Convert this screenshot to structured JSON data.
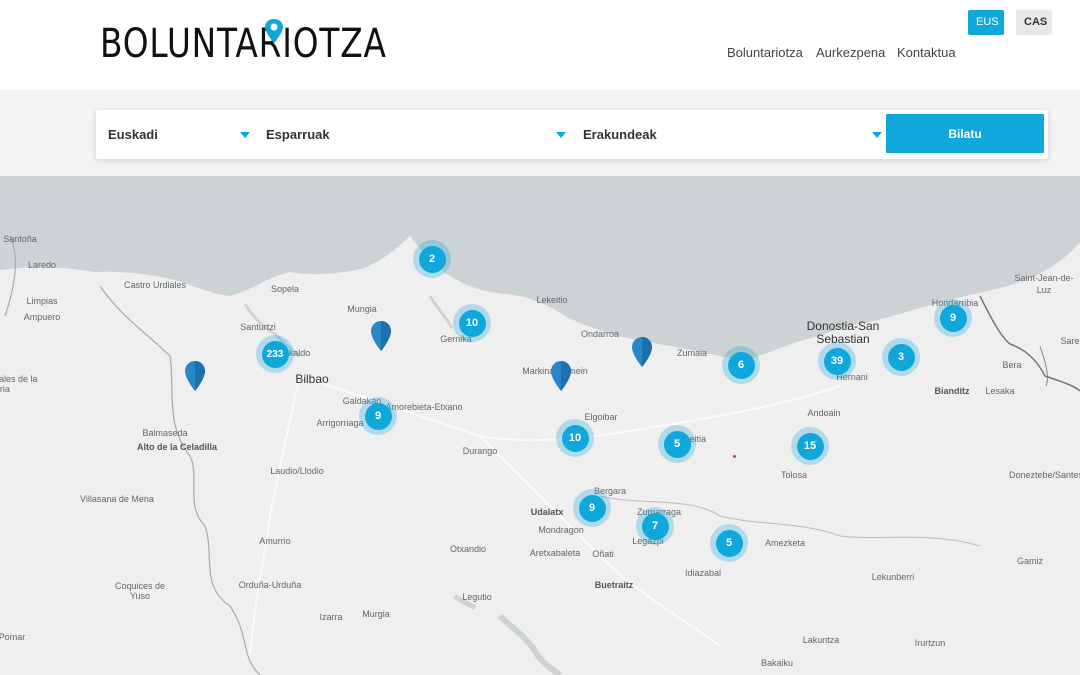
{
  "header": {
    "logo_text": "BOLUNTARIOTZA",
    "languages": [
      "EUS",
      "CAS"
    ],
    "nav": [
      "Boluntariotza",
      "Aurkezpena",
      "Kontaktua"
    ]
  },
  "search": {
    "region": "Euskadi",
    "area": "Esparruak",
    "org": "Erakundeak",
    "button": "Bilatu"
  },
  "map": {
    "places": [
      "Santoña",
      "Laredo",
      "Castro Urdiales",
      "Limpias",
      "Ampuero",
      "Sopela",
      "Mungia",
      "Santurtzi",
      "Bilbao",
      "Barakaldo",
      "Galdakao",
      "Arrigorriaga",
      "Amorebieta-Etxano",
      "Balmaseda",
      "Alto de la Celadilla",
      "Laudio/Llodio",
      "Villasana de Mena",
      "Amurrio",
      "Orduña-Urduña",
      "Izarra",
      "Murgia",
      "Otxandio",
      "Legutio",
      "Durango",
      "Elgoibar",
      "Bergara",
      "Udalatx",
      "Mondragon",
      "Aretxabaleta",
      "Oñati",
      "Buetraitz",
      "Zumarraga",
      "Legazpi",
      "Idiazabal",
      "Amezketa",
      "Tolosa",
      "Andoain",
      "Hernani",
      "Donostia-San Sebastian",
      "Hondarribia",
      "Saint-Jean-de-Luz",
      "Sare",
      "Bera",
      "Lesaka",
      "Bianditz",
      "Doneztebe/Santesteban",
      "Lekunberri",
      "Irurtzun",
      "Lakuntza",
      "Bakaiku",
      "Lekeitio",
      "Ondarroa",
      "Zumaia",
      "Gernika",
      "Markina-Xemein",
      "Azpeitia",
      "Gamiz",
      "Coquices de Yuso",
      "Ramales de la Victoria",
      "Pomar"
    ],
    "clusters": [
      "2",
      "10",
      "233",
      "9",
      "10",
      "5",
      "9",
      "7",
      "5",
      "6",
      "39",
      "3",
      "9",
      "15"
    ]
  },
  "colors": {
    "accent": "#10a7dc",
    "sea": "#cdd2d4",
    "land": "#efefef"
  }
}
